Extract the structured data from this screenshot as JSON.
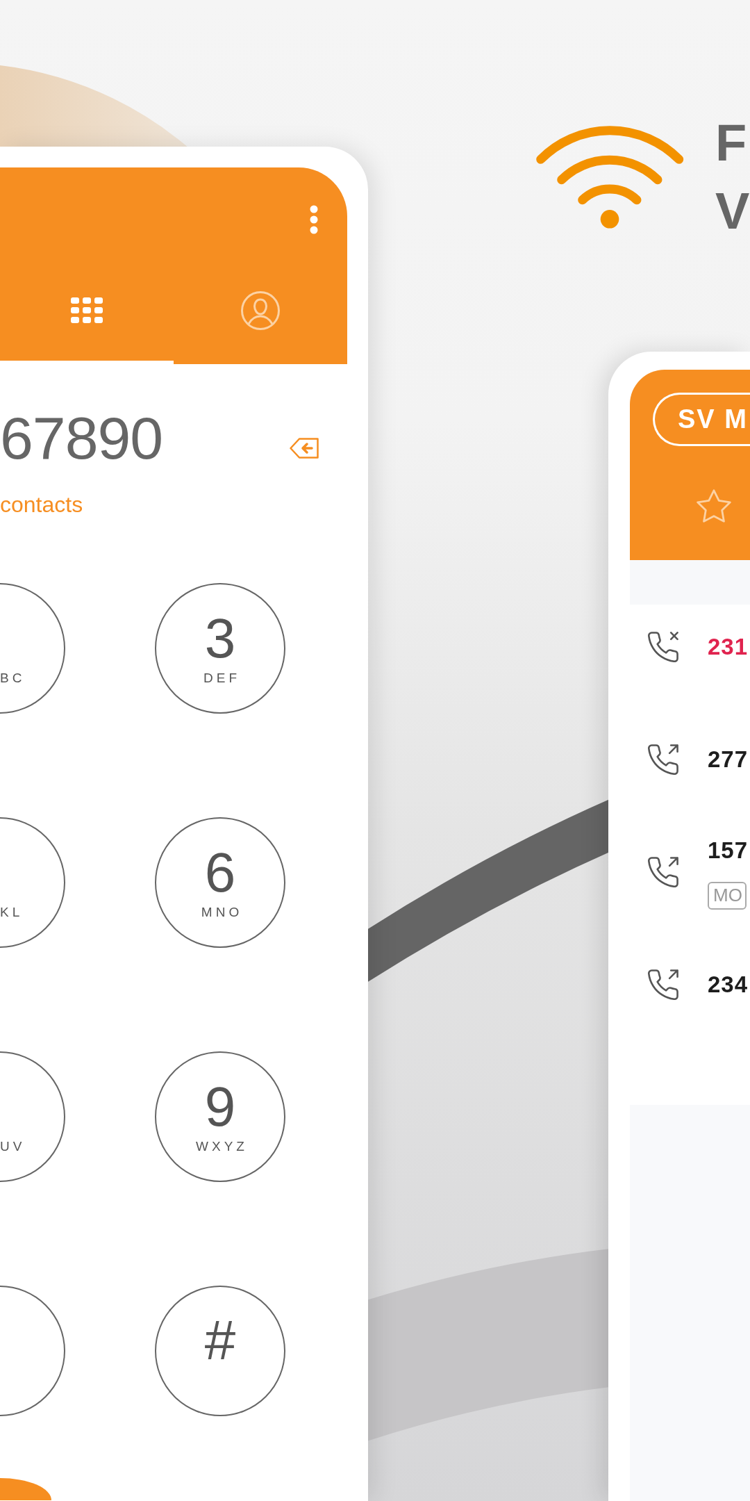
{
  "dialer": {
    "tabs": [
      {
        "kind": "dialpad",
        "selected": true
      },
      {
        "kind": "contacts",
        "selected": false
      }
    ],
    "number": "67890",
    "contacts_link": "contacts",
    "keypad_rows": [
      {
        "keys": [
          {
            "kind": "cut",
            "letters": "BC"
          },
          {
            "kind": "full",
            "digit": "3",
            "letters": "DEF"
          }
        ]
      },
      {
        "keys": [
          {
            "kind": "cut",
            "letters": "KL"
          },
          {
            "kind": "full",
            "digit": "6",
            "letters": "MNO"
          }
        ]
      },
      {
        "keys": [
          {
            "kind": "cut",
            "letters": "UV"
          },
          {
            "kind": "full",
            "digit": "9",
            "letters": "WXYZ"
          }
        ]
      },
      {
        "keys": [
          {
            "kind": "cut"
          },
          {
            "kind": "full",
            "digit": "#"
          }
        ]
      }
    ]
  },
  "headline": {
    "lines": [
      "F",
      "V"
    ]
  },
  "call_log": {
    "sim_chip": "SV M",
    "tabs": [
      {
        "kind": "favorites",
        "selected": false
      }
    ],
    "calls": [
      {
        "kind": "missed",
        "number": "231"
      },
      {
        "kind": "outgoing",
        "number": "277"
      },
      {
        "kind": "outgoing",
        "number": "157",
        "tag": "MO"
      },
      {
        "kind": "outgoing",
        "number": "234"
      }
    ]
  }
}
